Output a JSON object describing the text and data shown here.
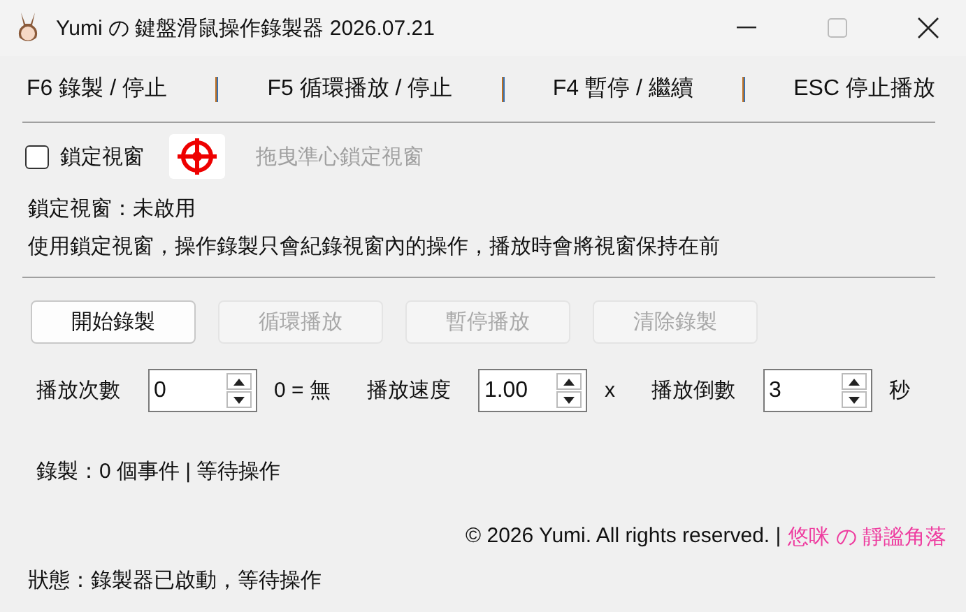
{
  "window": {
    "title": "Yumi の 鍵盤滑鼠操作錄製器 2026.07.21"
  },
  "hotkeys": [
    "F6 錄製 / 停止",
    "F5 循環播放 / 停止",
    "F4 暫停 / 繼續",
    "ESC 停止播放"
  ],
  "lock": {
    "label": "鎖定視窗",
    "checked": false,
    "drag_hint": "拖曳準心鎖定視窗",
    "drag_disabled": true
  },
  "lock_status": "鎖定視窗：未啟用",
  "description": "使用鎖定視窗，操作錄製只會紀錄視窗內的操作，播放時會將視窗保持在前",
  "buttons": [
    {
      "label": "開始錄製",
      "disabled": false
    },
    {
      "label": "循環播放",
      "disabled": true
    },
    {
      "label": "暫停播放",
      "disabled": true
    },
    {
      "label": "清除錄製",
      "disabled": true
    }
  ],
  "settings": [
    {
      "label": "播放次數",
      "value": "0",
      "suffix": "0 = 無"
    },
    {
      "label": "播放速度",
      "value": "1.00",
      "suffix": "x"
    },
    {
      "label": "播放倒數",
      "value": "3",
      "suffix": "秒"
    }
  ],
  "record_status": "錄製：0 個事件 | 等待操作",
  "footer": {
    "copyright": "© 2026 Yumi. All rights reserved. |",
    "link": "悠咪 の 靜謐角落"
  },
  "status_bar": "狀態：錄製器已啟動，等待操作"
}
